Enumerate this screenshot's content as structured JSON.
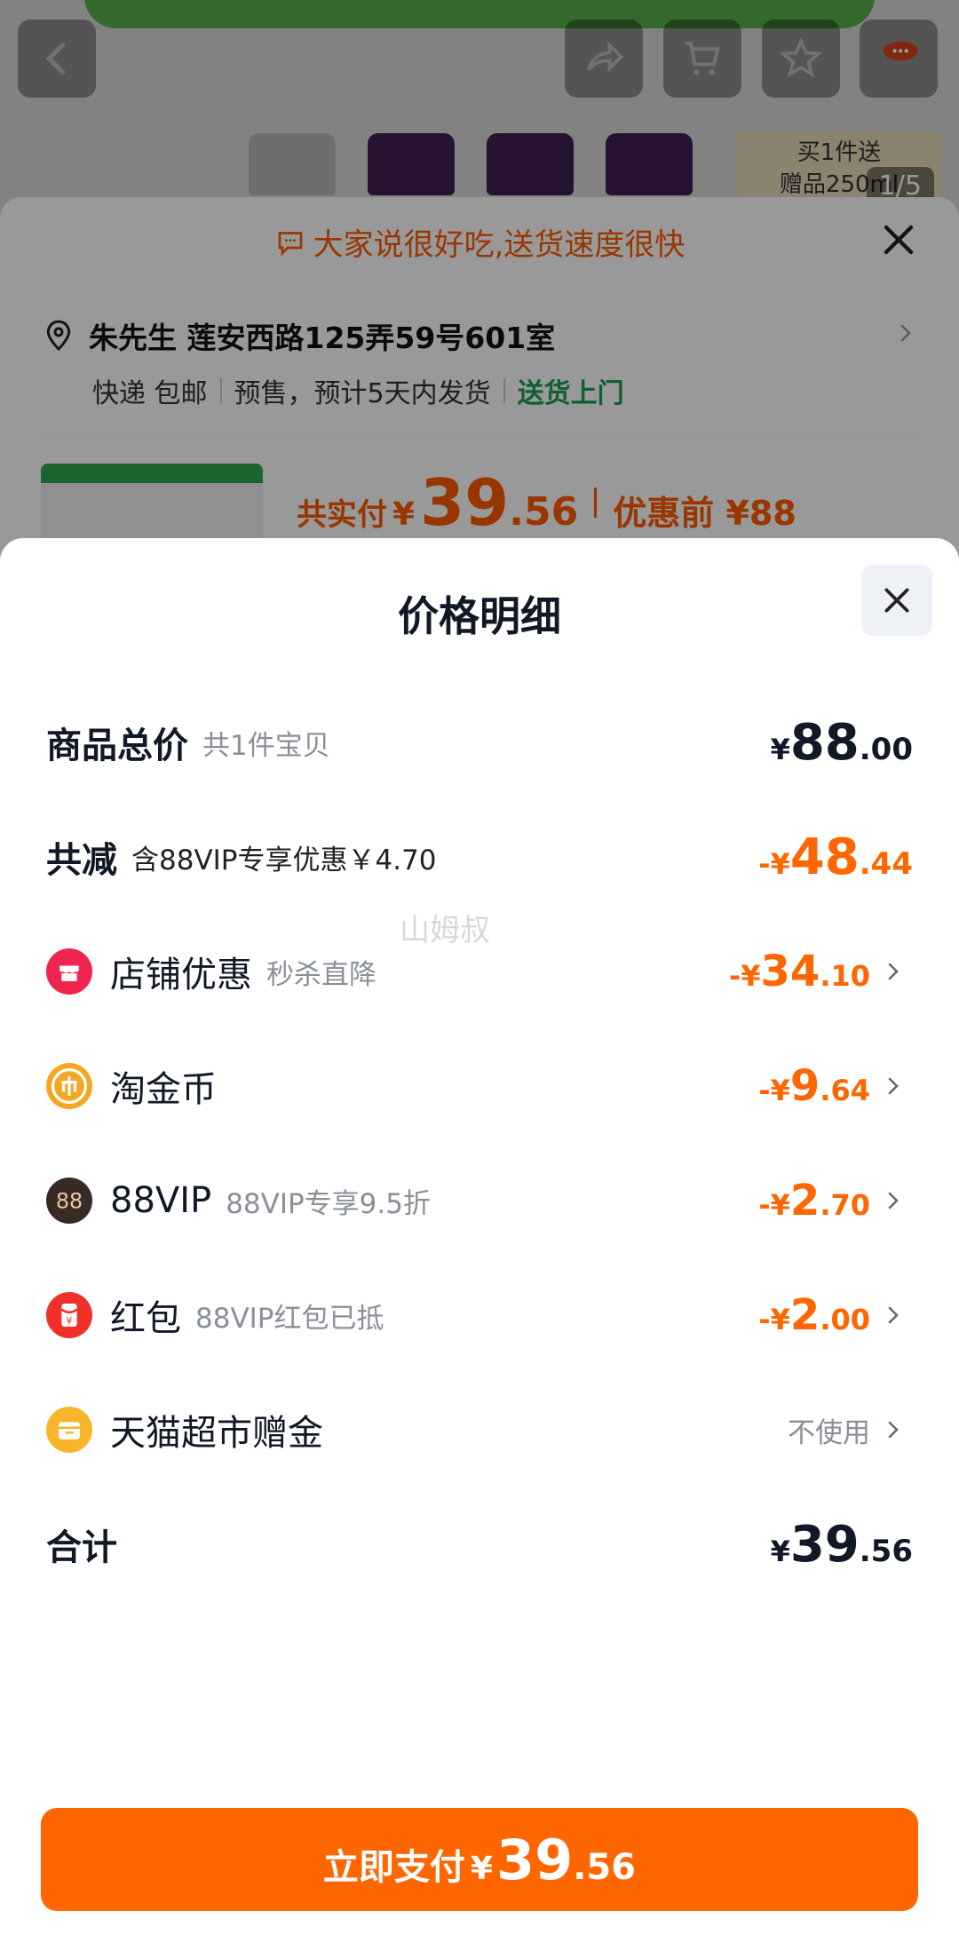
{
  "background": {
    "promo_tag": "买1件送\n赠品250ml",
    "page_indicator": "1/5"
  },
  "order_card": {
    "tip": "大家说很好吃,送货速度很快",
    "address": "朱先生 莲安西路125弄59号601室",
    "delivery": [
      "快递 包邮",
      "预售，预计5天内发货",
      "送货上门"
    ],
    "pay_label": "共实付",
    "pay_currency": "¥",
    "pay_int": "39",
    "pay_dec": ".56",
    "before_label": "优惠前 ¥88"
  },
  "sheet": {
    "title": "价格明细",
    "rows": [
      {
        "label": "商品总价",
        "sub": "共1件宝贝",
        "cur": "¥",
        "int": "88",
        "dec": ".00"
      },
      {
        "label": "共减",
        "sub": "含88VIP专享优惠￥4.70",
        "cur": "-¥",
        "int": "48",
        "dec": ".44"
      },
      {
        "label": "店铺优惠",
        "sub": "秒杀直降",
        "cur": "-¥",
        "int": "34",
        "dec": ".10"
      },
      {
        "label": "淘金币",
        "sub": "",
        "cur": "-¥",
        "int": "9",
        "dec": ".64"
      },
      {
        "label": "88VIP",
        "sub": "88VIP专享9.5折",
        "cur": "-¥",
        "int": "2",
        "dec": ".70"
      },
      {
        "label": "红包",
        "sub": "88VIP红包已抵",
        "cur": "-¥",
        "int": "2",
        "dec": ".00"
      },
      {
        "label": "天猫超市赠金",
        "sub": "",
        "value_text": "不使用"
      },
      {
        "label": "合计",
        "sub": "",
        "cur": "¥",
        "int": "39",
        "dec": ".56"
      }
    ],
    "pay_button": {
      "label": "立即支付",
      "cur": "¥",
      "int": "39",
      "dec": ".56"
    },
    "watermark": "山姆叔"
  },
  "colors": {
    "accent": "#ff6600",
    "green": "#1a9e52",
    "text": "#111827",
    "muted": "#8a8f99"
  },
  "icons": [
    "back-icon",
    "share-icon",
    "cart-icon",
    "star-icon",
    "more-icon",
    "chat-bubble-icon",
    "close-icon",
    "location-pin-icon",
    "chevron-right-icon",
    "shop-icon",
    "coin-icon",
    "vip-88-icon",
    "red-packet-icon",
    "gift-card-icon"
  ]
}
